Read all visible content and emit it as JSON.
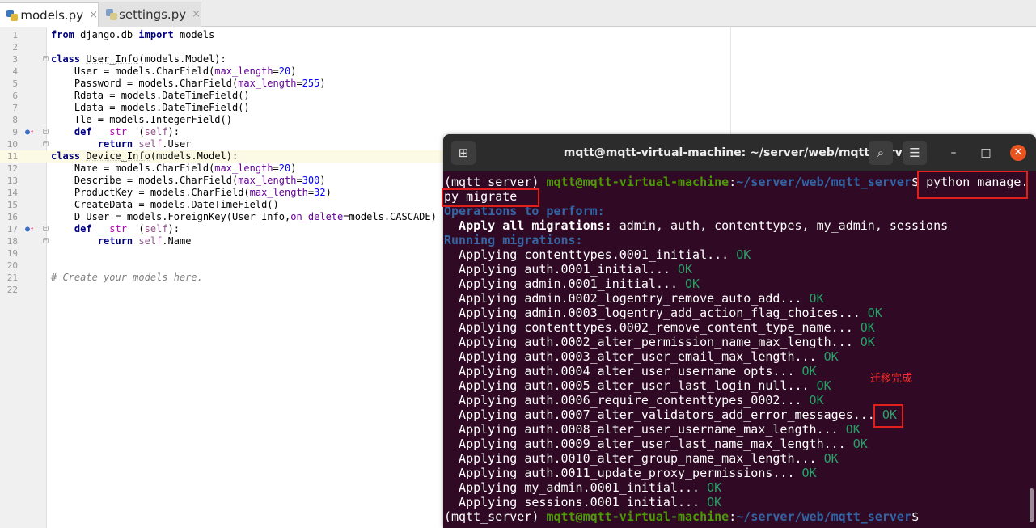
{
  "tabs": [
    {
      "label": "models.py",
      "close": "×"
    },
    {
      "label": "settings.py",
      "close": "×"
    }
  ],
  "code_lines": [
    {
      "n": "1",
      "t": "<span class=\"kw\">from</span> django.db <span class=\"kw\">import</span> models"
    },
    {
      "n": "2",
      "t": ""
    },
    {
      "n": "3",
      "t": "<span class=\"kw\">class</span> <span class=\"cls\">User_Info</span>(models.Model):"
    },
    {
      "n": "4",
      "t": "    User = models.CharField(<span class=\"param\">max_length</span>=<span class=\"num\">20</span>)"
    },
    {
      "n": "5",
      "t": "    Password = models.CharField(<span class=\"param\">max_length</span>=<span class=\"num\">255</span>)"
    },
    {
      "n": "6",
      "t": "    Rdata = models.DateTimeField()"
    },
    {
      "n": "7",
      "t": "    Ldata = models.DateTimeField()"
    },
    {
      "n": "8",
      "t": "    Tle = models.IntegerField()"
    },
    {
      "n": "9",
      "t": "    <span class=\"kw\">def</span> <span class=\"magic\">__str__</span>(<span class=\"self\">self</span>):"
    },
    {
      "n": "10",
      "t": "        <span class=\"kw\">return</span> <span class=\"self\">self</span>.User"
    },
    {
      "n": "11",
      "t": "<span class=\"kw\">class</span> <span class=\"cls\">Device_Info</span>(models.Model):"
    },
    {
      "n": "12",
      "t": "    Name = models.CharField(<span class=\"param\">max_length</span>=<span class=\"num\">20</span>)"
    },
    {
      "n": "13",
      "t": "    Describe = models.CharField(<span class=\"param\">max_length</span>=<span class=\"num\">300</span>)"
    },
    {
      "n": "14",
      "t": "    ProductKey = models.CharField(<span class=\"param\">max_length</span>=<span class=\"num\">32</span>)"
    },
    {
      "n": "15",
      "t": "    CreateData = models.DateTimeField()"
    },
    {
      "n": "16",
      "t": "    D_User = models.ForeignKey(User_Info,<span class=\"param\">on_delete</span>=models.CASCADE)"
    },
    {
      "n": "17",
      "t": "    <span class=\"kw\">def</span> <span class=\"magic\">__str__</span>(<span class=\"self\">self</span>):"
    },
    {
      "n": "18",
      "t": "        <span class=\"kw\">return</span> <span class=\"self\">self</span>.Name"
    },
    {
      "n": "19",
      "t": ""
    },
    {
      "n": "20",
      "t": ""
    },
    {
      "n": "21",
      "t": "<span class=\"comment\"># Create your models here.</span>"
    },
    {
      "n": "22",
      "t": ""
    }
  ],
  "terminal": {
    "title": "mqtt@mqtt-virtual-machine: ~/server/web/mqtt_server",
    "new_tab_icon": "⊞",
    "search_icon": "⌕",
    "menu_icon": "☰",
    "minimize": "–",
    "maximize": "□",
    "close": "✕",
    "venv": "(mqtt_server) ",
    "user_host": "mqtt@mqtt-virtual-machine",
    "colon": ":",
    "path": "~/server/web/mqtt_server",
    "dollar": "$ ",
    "command_part1": "python manage.",
    "command_part2": "py migrate",
    "ops_header": "Operations to perform:",
    "apply_all_label": "  Apply all migrations:",
    "apply_all_apps": " admin, auth, contenttypes, my_admin, sessions",
    "running_header": "Running migrations:",
    "migrations": [
      {
        "text": "  Applying contenttypes.0001_initial...",
        "ok": "OK"
      },
      {
        "text": "  Applying auth.0001_initial...",
        "ok": "OK"
      },
      {
        "text": "  Applying admin.0001_initial...",
        "ok": "OK"
      },
      {
        "text": "  Applying admin.0002_logentry_remove_auto_add...",
        "ok": "OK"
      },
      {
        "text": "  Applying admin.0003_logentry_add_action_flag_choices...",
        "ok": "OK"
      },
      {
        "text": "  Applying contenttypes.0002_remove_content_type_name...",
        "ok": "OK"
      },
      {
        "text": "  Applying auth.0002_alter_permission_name_max_length...",
        "ok": "OK"
      },
      {
        "text": "  Applying auth.0003_alter_user_email_max_length...",
        "ok": "OK"
      },
      {
        "text": "  Applying auth.0004_alter_user_username_opts...",
        "ok": "OK"
      },
      {
        "text": "  Applying auth.0005_alter_user_last_login_null...",
        "ok": "OK"
      },
      {
        "text": "  Applying auth.0006_require_contenttypes_0002...",
        "ok": "OK"
      },
      {
        "text": "  Applying auth.0007_alter_validators_add_error_messages...",
        "ok": "OK"
      },
      {
        "text": "  Applying auth.0008_alter_user_username_max_length...",
        "ok": "OK"
      },
      {
        "text": "  Applying auth.0009_alter_user_last_name_max_length...",
        "ok": "OK"
      },
      {
        "text": "  Applying auth.0010_alter_group_name_max_length...",
        "ok": "OK"
      },
      {
        "text": "  Applying auth.0011_update_proxy_permissions...",
        "ok": "OK"
      },
      {
        "text": "  Applying my_admin.0001_initial...",
        "ok": "OK"
      },
      {
        "text": "  Applying sessions.0001_initial...",
        "ok": "OK"
      }
    ]
  },
  "annotation": "迁移完成",
  "colors": {
    "terminal_bg": "#300a24",
    "prompt_green": "#4e9a06",
    "path_blue": "#3465a4",
    "ok_green": "#26a269",
    "highlight_red": "#e0201c"
  }
}
